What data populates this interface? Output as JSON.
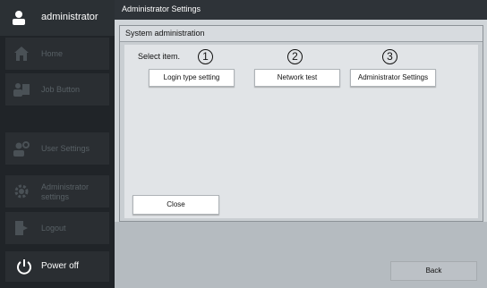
{
  "sidebar": {
    "user_name": "administrator",
    "items": [
      {
        "label": "Home",
        "icon": "home-icon"
      },
      {
        "label": "Job Button",
        "icon": "job-button-icon"
      },
      {
        "label": "",
        "icon": ""
      },
      {
        "label": "User Settings",
        "icon": "user-settings-icon"
      },
      {
        "label": "Administrator settings",
        "icon": "gear-icon"
      },
      {
        "label": "Logout",
        "icon": "logout-icon"
      }
    ],
    "power_label": "Power off"
  },
  "header": {
    "title": "Administrator Settings"
  },
  "panel": {
    "title": "System administration",
    "prompt": "Select item.",
    "buttons": [
      {
        "label": "Login type setting",
        "number": "1"
      },
      {
        "label": "Network test",
        "number": "2"
      },
      {
        "label": "Administrator Settings",
        "number": "3"
      }
    ],
    "close_label": "Close"
  },
  "footer": {
    "back_label": "Back"
  },
  "colors": {
    "sidebar_bg": "#202428",
    "header_bg": "#2e3338",
    "panel_bg": "#e1e4e7",
    "button_bg": "#ffffff"
  }
}
